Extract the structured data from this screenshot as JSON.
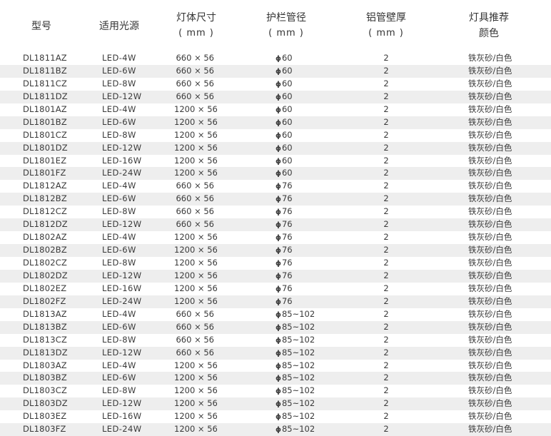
{
  "headers": {
    "model": "型号",
    "light_source": "适用光源",
    "lamp_size": [
      "灯体尺寸",
      "( mm )"
    ],
    "pipe_diameter": [
      "护栏管径",
      "( mm )"
    ],
    "wall_thickness": [
      "铝管壁厚",
      "( mm )"
    ],
    "color": [
      "灯具推荐",
      "颜色"
    ]
  },
  "rows": [
    {
      "model": "DL1811AZ",
      "light": "LED-4W",
      "size": "660 × 56",
      "pipe": "60",
      "thick": "2",
      "color": "铁灰砂/白色"
    },
    {
      "model": "DL1811BZ",
      "light": "LED-6W",
      "size": "660 × 56",
      "pipe": "60",
      "thick": "2",
      "color": "铁灰砂/白色"
    },
    {
      "model": "DL1811CZ",
      "light": "LED-8W",
      "size": "660 × 56",
      "pipe": "60",
      "thick": "2",
      "color": "铁灰砂/白色"
    },
    {
      "model": "DL1811DZ",
      "light": "LED-12W",
      "size": "660 × 56",
      "pipe": "60",
      "thick": "2",
      "color": "铁灰砂/白色"
    },
    {
      "model": "DL1801AZ",
      "light": "LED-4W",
      "size": "1200 × 56",
      "pipe": "60",
      "thick": "2",
      "color": "铁灰砂/白色"
    },
    {
      "model": "DL1801BZ",
      "light": "LED-6W",
      "size": "1200 × 56",
      "pipe": "60",
      "thick": "2",
      "color": "铁灰砂/白色"
    },
    {
      "model": "DL1801CZ",
      "light": "LED-8W",
      "size": "1200 × 56",
      "pipe": "60",
      "thick": "2",
      "color": "铁灰砂/白色"
    },
    {
      "model": "DL1801DZ",
      "light": "LED-12W",
      "size": "1200 × 56",
      "pipe": "60",
      "thick": "2",
      "color": "铁灰砂/白色"
    },
    {
      "model": "DL1801EZ",
      "light": "LED-16W",
      "size": "1200 × 56",
      "pipe": "60",
      "thick": "2",
      "color": "铁灰砂/白色"
    },
    {
      "model": "DL1801FZ",
      "light": "LED-24W",
      "size": "1200 × 56",
      "pipe": "60",
      "thick": "2",
      "color": "铁灰砂/白色"
    },
    {
      "model": "DL1812AZ",
      "light": "LED-4W",
      "size": "660 × 56",
      "pipe": "76",
      "thick": "2",
      "color": "铁灰砂/白色"
    },
    {
      "model": "DL1812BZ",
      "light": "LED-6W",
      "size": "660 × 56",
      "pipe": "76",
      "thick": "2",
      "color": "铁灰砂/白色"
    },
    {
      "model": "DL1812CZ",
      "light": "LED-8W",
      "size": "660 × 56",
      "pipe": "76",
      "thick": "2",
      "color": "铁灰砂/白色"
    },
    {
      "model": "DL1812DZ",
      "light": "LED-12W",
      "size": "660 × 56",
      "pipe": "76",
      "thick": "2",
      "color": "铁灰砂/白色"
    },
    {
      "model": "DL1802AZ",
      "light": "LED-4W",
      "size": "1200 × 56",
      "pipe": "76",
      "thick": "2",
      "color": "铁灰砂/白色"
    },
    {
      "model": "DL1802BZ",
      "light": "LED-6W",
      "size": "1200 × 56",
      "pipe": "76",
      "thick": "2",
      "color": "铁灰砂/白色"
    },
    {
      "model": "DL1802CZ",
      "light": "LED-8W",
      "size": "1200 × 56",
      "pipe": "76",
      "thick": "2",
      "color": "铁灰砂/白色"
    },
    {
      "model": "DL1802DZ",
      "light": "LED-12W",
      "size": "1200 × 56",
      "pipe": "76",
      "thick": "2",
      "color": "铁灰砂/白色"
    },
    {
      "model": "DL1802EZ",
      "light": "LED-16W",
      "size": "1200 × 56",
      "pipe": "76",
      "thick": "2",
      "color": "铁灰砂/白色"
    },
    {
      "model": "DL1802FZ",
      "light": "LED-24W",
      "size": "1200 × 56",
      "pipe": "76",
      "thick": "2",
      "color": "铁灰砂/白色"
    },
    {
      "model": "DL1813AZ",
      "light": "LED-4W",
      "size": "660 × 56",
      "pipe": "85~102",
      "thick": "2",
      "color": "铁灰砂/白色"
    },
    {
      "model": "DL1813BZ",
      "light": "LED-6W",
      "size": "660 × 56",
      "pipe": "85~102",
      "thick": "2",
      "color": "铁灰砂/白色"
    },
    {
      "model": "DL1813CZ",
      "light": "LED-8W",
      "size": "660 × 56",
      "pipe": "85~102",
      "thick": "2",
      "color": "铁灰砂/白色"
    },
    {
      "model": "DL1813DZ",
      "light": "LED-12W",
      "size": "660 × 56",
      "pipe": "85~102",
      "thick": "2",
      "color": "铁灰砂/白色"
    },
    {
      "model": "DL1803AZ",
      "light": "LED-4W",
      "size": "1200 × 56",
      "pipe": "85~102",
      "thick": "2",
      "color": "铁灰砂/白色"
    },
    {
      "model": "DL1803BZ",
      "light": "LED-6W",
      "size": "1200 × 56",
      "pipe": "85~102",
      "thick": "2",
      "color": "铁灰砂/白色"
    },
    {
      "model": "DL1803CZ",
      "light": "LED-8W",
      "size": "1200 × 56",
      "pipe": "85~102",
      "thick": "2",
      "color": "铁灰砂/白色"
    },
    {
      "model": "DL1803DZ",
      "light": "LED-12W",
      "size": "1200 × 56",
      "pipe": "85~102",
      "thick": "2",
      "color": "铁灰砂/白色"
    },
    {
      "model": "DL1803EZ",
      "light": "LED-16W",
      "size": "1200 × 56",
      "pipe": "85~102",
      "thick": "2",
      "color": "铁灰砂/白色"
    },
    {
      "model": "DL1803FZ",
      "light": "LED-24W",
      "size": "1200 × 56",
      "pipe": "85~102",
      "thick": "2",
      "color": "铁灰砂/白色"
    }
  ],
  "diameter_symbol": "ϕ",
  "colors": {
    "stripe": "#eeeeee",
    "text": "#333333"
  }
}
